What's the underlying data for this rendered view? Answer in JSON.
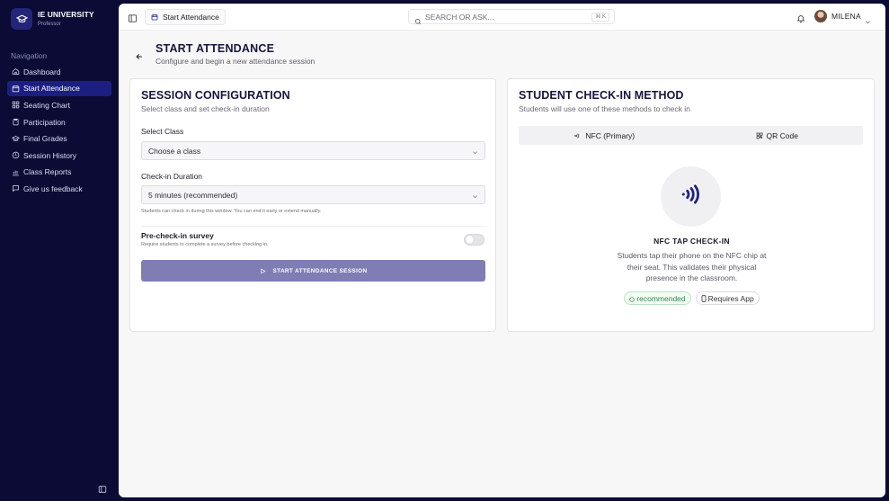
{
  "brand": {
    "name": "IE UNIVERSITY",
    "role": "Professor"
  },
  "sidebar": {
    "heading": "Navigation",
    "items": [
      {
        "label": "Dashboard",
        "icon": "home-icon"
      },
      {
        "label": "Start Attendance",
        "icon": "calendar-icon",
        "active": true
      },
      {
        "label": "Seating Chart",
        "icon": "grid-icon"
      },
      {
        "label": "Participation",
        "icon": "clipboard-icon"
      },
      {
        "label": "Final Grades",
        "icon": "graduation-cap-icon"
      },
      {
        "label": "Session History",
        "icon": "history-icon"
      },
      {
        "label": "Class Reports",
        "icon": "bar-chart-icon"
      },
      {
        "label": "Give us feedback",
        "icon": "message-icon"
      }
    ]
  },
  "topbar": {
    "breadcrumb": "Start Attendance",
    "search_placeholder": "SEARCH OR ASK...",
    "shortcut": "⌘ K",
    "user_name": "MILENA"
  },
  "page": {
    "title": "START ATTENDANCE",
    "subtitle": "Configure and begin a new attendance session"
  },
  "config": {
    "title": "SESSION CONFIGURATION",
    "subtitle": "Select class and set check-in duration",
    "class_label": "Select Class",
    "class_value": "Choose a class",
    "duration_label": "Check-in Duration",
    "duration_value": "5 minutes (recommended)",
    "duration_hint": "Students can check in during this window. You can end it early or extend manually.",
    "survey_title": "Pre-check-in survey",
    "survey_sub": "Require students to complete a survey before checking in.",
    "survey_enabled": false,
    "start_button": "START ATTENDANCE SESSION"
  },
  "checkin": {
    "title": "STUDENT CHECK-IN METHOD",
    "subtitle": "Students will use one of these methods to check in",
    "tabs": [
      "NFC (Primary)",
      "QR Code"
    ],
    "method_title": "NFC TAP CHECK-IN",
    "method_desc": "Students tap their phone on the NFC chip at their seat. This validates their physical presence in the classroom.",
    "badges": [
      "recommended",
      "Requires App"
    ]
  },
  "colors": {
    "sidebar_bg": "#0b0b35",
    "active_nav": "#1c1e80",
    "primary_button": "#7f7db3",
    "nfc_icon": "#23257a"
  }
}
